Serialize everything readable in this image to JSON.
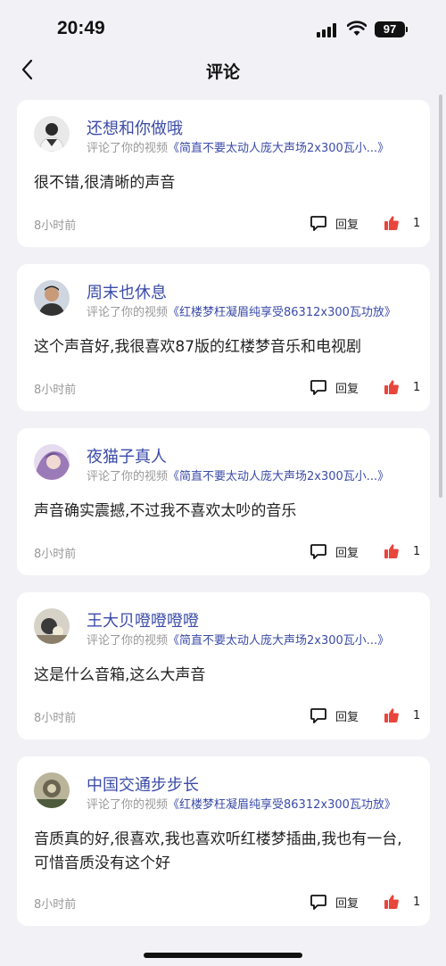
{
  "status_bar": {
    "time": "20:49",
    "battery": "97",
    "icons": [
      "signal-icon",
      "wifi-icon",
      "battery-icon"
    ]
  },
  "nav": {
    "back_icon": "chevron-left-icon",
    "title": "评论"
  },
  "comments": [
    {
      "username": "还想和你做哦",
      "action": "评论了你的视频",
      "video_title": "《简直不要太动人庞大声场2x300瓦小...》",
      "text": "很不错,很清晰的声音",
      "time_ago": "8小时前",
      "reply_label": "回复",
      "like_count": "1"
    },
    {
      "username": "周末也休息",
      "action": "评论了你的视频",
      "video_title": "《红楼梦枉凝眉纯享受86312x300瓦功放》",
      "text": "这个声音好,我很喜欢87版的红楼梦音乐和电视剧",
      "time_ago": "8小时前",
      "reply_label": "回复",
      "like_count": "1"
    },
    {
      "username": "夜猫子真人",
      "action": "评论了你的视频",
      "video_title": "《简直不要太动人庞大声场2x300瓦小...》",
      "text": "声音确实震撼,不过我不喜欢太吵的音乐",
      "time_ago": "8小时前",
      "reply_label": "回复",
      "like_count": "1"
    },
    {
      "username": "王大贝噔噔噔噔",
      "action": "评论了你的视频",
      "video_title": "《简直不要太动人庞大声场2x300瓦小...》",
      "text": "这是什么音箱,这么大声音",
      "time_ago": "8小时前",
      "reply_label": "回复",
      "like_count": "1"
    },
    {
      "username": "中国交通步步长",
      "action": "评论了你的视频",
      "video_title": "《红楼梦枉凝眉纯享受86312x300瓦功放》",
      "text": "音质真的好,很喜欢,我也喜欢听红楼梦插曲,我也有一台,可惜音质没有这个好",
      "time_ago": "8小时前",
      "reply_label": "回复",
      "like_count": "1"
    }
  ],
  "colors": {
    "background": "#f2f2f6",
    "card": "#ffffff",
    "username": "#3b4ba8",
    "like": "#e8453c",
    "secondary_text": "#999999"
  }
}
